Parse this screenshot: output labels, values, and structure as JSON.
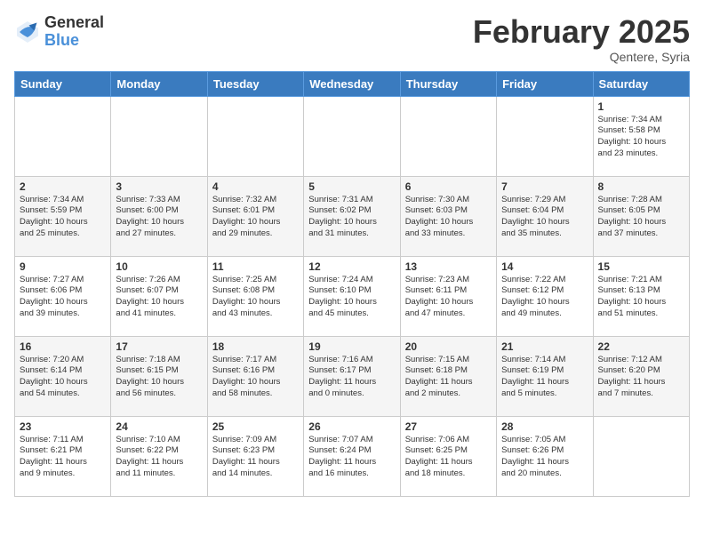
{
  "header": {
    "logo_general": "General",
    "logo_blue": "Blue",
    "month_title": "February 2025",
    "location": "Qentere, Syria"
  },
  "days_of_week": [
    "Sunday",
    "Monday",
    "Tuesday",
    "Wednesday",
    "Thursday",
    "Friday",
    "Saturday"
  ],
  "weeks": [
    [
      {
        "num": "",
        "info": ""
      },
      {
        "num": "",
        "info": ""
      },
      {
        "num": "",
        "info": ""
      },
      {
        "num": "",
        "info": ""
      },
      {
        "num": "",
        "info": ""
      },
      {
        "num": "",
        "info": ""
      },
      {
        "num": "1",
        "info": "Sunrise: 7:34 AM\nSunset: 5:58 PM\nDaylight: 10 hours\nand 23 minutes."
      }
    ],
    [
      {
        "num": "2",
        "info": "Sunrise: 7:34 AM\nSunset: 5:59 PM\nDaylight: 10 hours\nand 25 minutes."
      },
      {
        "num": "3",
        "info": "Sunrise: 7:33 AM\nSunset: 6:00 PM\nDaylight: 10 hours\nand 27 minutes."
      },
      {
        "num": "4",
        "info": "Sunrise: 7:32 AM\nSunset: 6:01 PM\nDaylight: 10 hours\nand 29 minutes."
      },
      {
        "num": "5",
        "info": "Sunrise: 7:31 AM\nSunset: 6:02 PM\nDaylight: 10 hours\nand 31 minutes."
      },
      {
        "num": "6",
        "info": "Sunrise: 7:30 AM\nSunset: 6:03 PM\nDaylight: 10 hours\nand 33 minutes."
      },
      {
        "num": "7",
        "info": "Sunrise: 7:29 AM\nSunset: 6:04 PM\nDaylight: 10 hours\nand 35 minutes."
      },
      {
        "num": "8",
        "info": "Sunrise: 7:28 AM\nSunset: 6:05 PM\nDaylight: 10 hours\nand 37 minutes."
      }
    ],
    [
      {
        "num": "9",
        "info": "Sunrise: 7:27 AM\nSunset: 6:06 PM\nDaylight: 10 hours\nand 39 minutes."
      },
      {
        "num": "10",
        "info": "Sunrise: 7:26 AM\nSunset: 6:07 PM\nDaylight: 10 hours\nand 41 minutes."
      },
      {
        "num": "11",
        "info": "Sunrise: 7:25 AM\nSunset: 6:08 PM\nDaylight: 10 hours\nand 43 minutes."
      },
      {
        "num": "12",
        "info": "Sunrise: 7:24 AM\nSunset: 6:10 PM\nDaylight: 10 hours\nand 45 minutes."
      },
      {
        "num": "13",
        "info": "Sunrise: 7:23 AM\nSunset: 6:11 PM\nDaylight: 10 hours\nand 47 minutes."
      },
      {
        "num": "14",
        "info": "Sunrise: 7:22 AM\nSunset: 6:12 PM\nDaylight: 10 hours\nand 49 minutes."
      },
      {
        "num": "15",
        "info": "Sunrise: 7:21 AM\nSunset: 6:13 PM\nDaylight: 10 hours\nand 51 minutes."
      }
    ],
    [
      {
        "num": "16",
        "info": "Sunrise: 7:20 AM\nSunset: 6:14 PM\nDaylight: 10 hours\nand 54 minutes."
      },
      {
        "num": "17",
        "info": "Sunrise: 7:18 AM\nSunset: 6:15 PM\nDaylight: 10 hours\nand 56 minutes."
      },
      {
        "num": "18",
        "info": "Sunrise: 7:17 AM\nSunset: 6:16 PM\nDaylight: 10 hours\nand 58 minutes."
      },
      {
        "num": "19",
        "info": "Sunrise: 7:16 AM\nSunset: 6:17 PM\nDaylight: 11 hours\nand 0 minutes."
      },
      {
        "num": "20",
        "info": "Sunrise: 7:15 AM\nSunset: 6:18 PM\nDaylight: 11 hours\nand 2 minutes."
      },
      {
        "num": "21",
        "info": "Sunrise: 7:14 AM\nSunset: 6:19 PM\nDaylight: 11 hours\nand 5 minutes."
      },
      {
        "num": "22",
        "info": "Sunrise: 7:12 AM\nSunset: 6:20 PM\nDaylight: 11 hours\nand 7 minutes."
      }
    ],
    [
      {
        "num": "23",
        "info": "Sunrise: 7:11 AM\nSunset: 6:21 PM\nDaylight: 11 hours\nand 9 minutes."
      },
      {
        "num": "24",
        "info": "Sunrise: 7:10 AM\nSunset: 6:22 PM\nDaylight: 11 hours\nand 11 minutes."
      },
      {
        "num": "25",
        "info": "Sunrise: 7:09 AM\nSunset: 6:23 PM\nDaylight: 11 hours\nand 14 minutes."
      },
      {
        "num": "26",
        "info": "Sunrise: 7:07 AM\nSunset: 6:24 PM\nDaylight: 11 hours\nand 16 minutes."
      },
      {
        "num": "27",
        "info": "Sunrise: 7:06 AM\nSunset: 6:25 PM\nDaylight: 11 hours\nand 18 minutes."
      },
      {
        "num": "28",
        "info": "Sunrise: 7:05 AM\nSunset: 6:26 PM\nDaylight: 11 hours\nand 20 minutes."
      },
      {
        "num": "",
        "info": ""
      }
    ]
  ]
}
